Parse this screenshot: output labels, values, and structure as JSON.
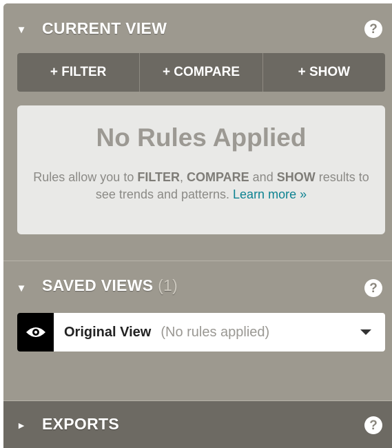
{
  "current_view": {
    "caret": "▼",
    "title": "CURRENT VIEW",
    "help": "?",
    "buttons": [
      {
        "label": "+ FILTER"
      },
      {
        "label": "+ COMPARE"
      },
      {
        "label": "+ SHOW"
      }
    ],
    "empty_state": {
      "title": "No Rules Applied",
      "text_1": "Rules allow you to ",
      "filter": "FILTER",
      "comma": ", ",
      "compare": "COMPARE",
      "and": " and ",
      "show": "SHOW",
      "text_2": " results to see trends and patterns. ",
      "learn_more": "Learn more »"
    }
  },
  "saved_views": {
    "caret": "▼",
    "title": "SAVED VIEWS",
    "count": "(1)",
    "help": "?",
    "items": [
      {
        "name": "Original View",
        "note": "(No rules applied)"
      }
    ]
  },
  "exports": {
    "caret": "►",
    "title": "EXPORTS",
    "help": "?"
  },
  "colors": {
    "panel_bg": "#9d998f",
    "button_bar": "#6c6962",
    "exports_bg": "#6d6a63",
    "link": "#0d8291"
  }
}
